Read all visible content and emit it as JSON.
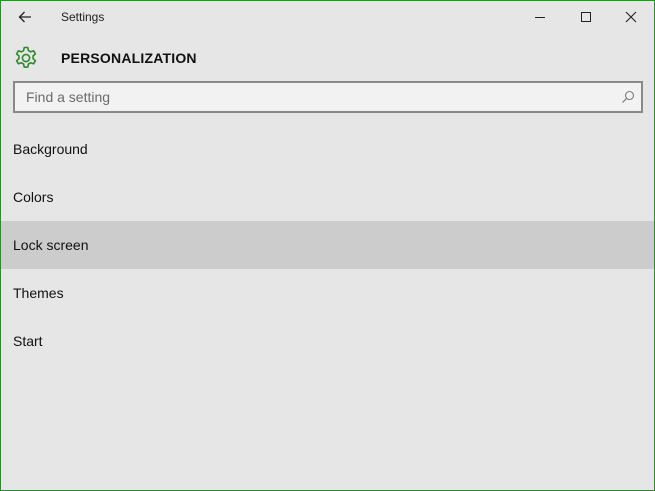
{
  "window": {
    "title": "Settings",
    "accent_color": "#2f8a2f"
  },
  "titlebar": {
    "back_icon": "arrow-left-icon",
    "minimize_icon": "minimize-icon",
    "maximize_icon": "maximize-icon",
    "close_icon": "close-icon"
  },
  "header": {
    "icon": "gear-icon",
    "title": "PERSONALIZATION"
  },
  "search": {
    "value": "",
    "placeholder": "Find a setting",
    "icon": "search-icon"
  },
  "nav": {
    "items": [
      {
        "label": "Background",
        "selected": false
      },
      {
        "label": "Colors",
        "selected": false
      },
      {
        "label": "Lock screen",
        "selected": true
      },
      {
        "label": "Themes",
        "selected": false
      },
      {
        "label": "Start",
        "selected": false
      }
    ]
  }
}
